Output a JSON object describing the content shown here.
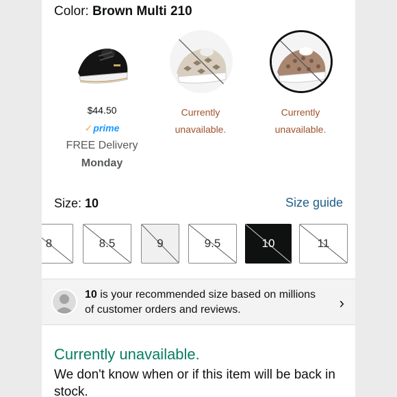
{
  "color": {
    "prefix": "Color: ",
    "value": "Brown Multi 210"
  },
  "swatches": [
    {
      "price": "$44.50",
      "prime_label": "prime",
      "delivery": "FREE Delivery",
      "day": "Monday"
    },
    {
      "status_line1": "Currently",
      "status_line2": "unavailable."
    },
    {
      "status_line1": "Currently",
      "status_line2": "unavailable."
    }
  ],
  "size": {
    "prefix": "Size: ",
    "value": "10",
    "guide_label": "Size guide"
  },
  "sizes": [
    "8",
    "8.5",
    "9",
    "9.5",
    "10",
    "11"
  ],
  "recommendation": {
    "size": "10",
    "line1": " is your recommended size based on millions",
    "line2": "of customer orders and reviews."
  },
  "availability": {
    "title": "Currently unavailable.",
    "body": "We don't know when or if this item will be back in stock."
  },
  "colors": {
    "prime_blue": "#1a98ff",
    "unavailable_brown": "#a0522d",
    "link_blue": "#1f5f89",
    "oos_green": "#067d62"
  }
}
